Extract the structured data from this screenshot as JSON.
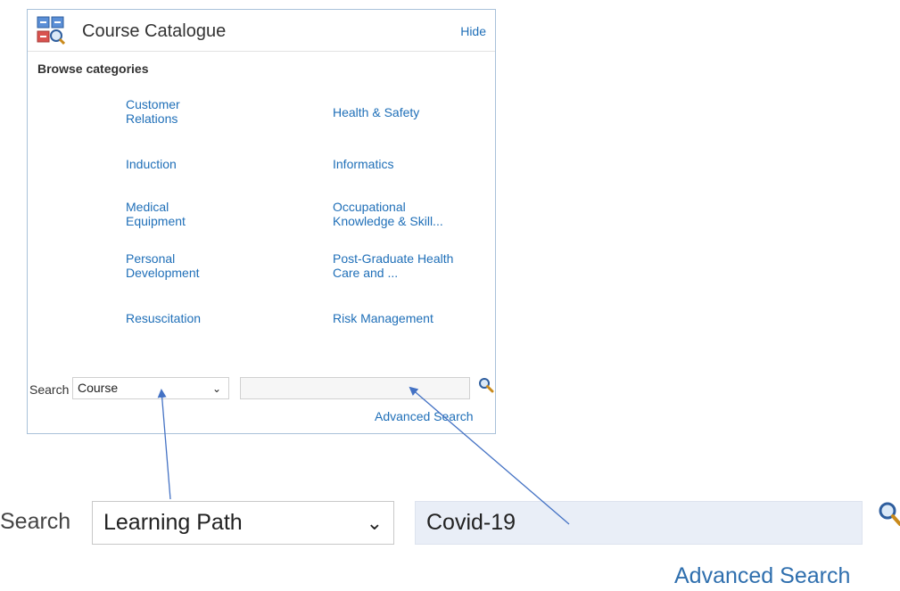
{
  "catalogue": {
    "title": "Course Catalogue",
    "hide_label": "Hide",
    "browse_label": "Browse categories",
    "categories": [
      {
        "line1": "Customer",
        "line2": "Relations"
      },
      {
        "line1": "Health & Safety",
        "line2": ""
      },
      {
        "line1": "Induction",
        "line2": ""
      },
      {
        "line1": "Informatics",
        "line2": ""
      },
      {
        "line1": "Medical",
        "line2": "Equipment"
      },
      {
        "line1": "Occupational",
        "line2": "Knowledge & Skill..."
      },
      {
        "line1": "Personal",
        "line2": "Development"
      },
      {
        "line1": "Post-Graduate Health",
        "line2": "Care and ..."
      },
      {
        "line1": "Resuscitation",
        "line2": ""
      },
      {
        "line1": "Risk Management",
        "line2": ""
      }
    ],
    "search": {
      "label": "Search",
      "type_selected": "Course",
      "query_value": "",
      "advanced_label": "Advanced Search"
    }
  },
  "zoom": {
    "search_label": "Search",
    "type_selected": "Learning Path",
    "query_value": "Covid-19",
    "advanced_label": "Advanced Search"
  },
  "colors": {
    "link": "#1f6fb8",
    "panel_border": "#a9c1d9",
    "arrow": "#4472c4",
    "zoom_input_bg": "#e9eef7"
  },
  "icons": [
    "course-catalogue-icon",
    "magnifier-icon",
    "chevron-down-icon"
  ]
}
